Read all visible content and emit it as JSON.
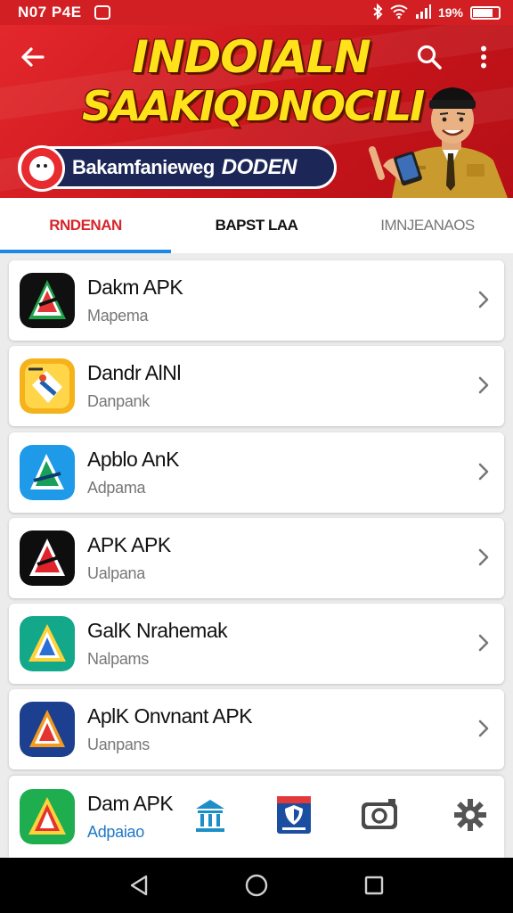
{
  "status": {
    "time": "N07 P4E",
    "battery_text": "19%",
    "battery_level": 0.8
  },
  "banner": {
    "line1": "INDOIALN",
    "line2": "SAAKIQDNOCILI",
    "pill_text": "Bakamfanieweg",
    "pill_emphasis": "DODEN"
  },
  "tabs": [
    {
      "label": "RNDENAN",
      "active": true
    },
    {
      "label": "BAPST LAA",
      "active": false
    },
    {
      "label": "IMNJEANAOS",
      "active": false
    }
  ],
  "apps": [
    {
      "name": "Dakm APK",
      "subtitle": "Mapema",
      "icon": "apk-icon-green-black"
    },
    {
      "name": "Dandr AlNl",
      "subtitle": "Danpank",
      "icon": "apk-icon-yellow"
    },
    {
      "name": "Apblo AnK",
      "subtitle": "Adpama",
      "icon": "apk-icon-blue"
    },
    {
      "name": "APK APK",
      "subtitle": "Ualpana",
      "icon": "apk-icon-black-red"
    },
    {
      "name": "GalK Nrahemak",
      "subtitle": "Nalpams",
      "icon": "apk-icon-teal"
    },
    {
      "name": "AplK Onvnant APK",
      "subtitle": "Uanpans",
      "icon": "apk-icon-navy"
    }
  ],
  "bottom_app": {
    "name": "Dam APK",
    "subtitle": "Adpaiao",
    "icon": "apk-icon-green"
  },
  "bottom_nav": [
    "bank-icon",
    "shield-card-icon",
    "camera-icon",
    "settings-gear-icon"
  ],
  "colors": {
    "brand_red": "#d21f24",
    "accent_blue": "#1e88e5",
    "banner_yellow": "#ffe21a",
    "pill_navy": "#1c2757"
  }
}
